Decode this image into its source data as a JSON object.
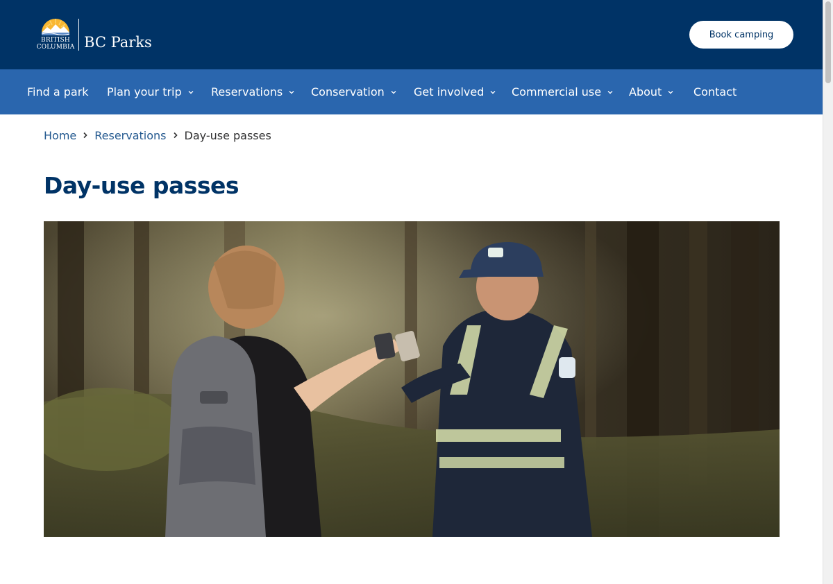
{
  "header": {
    "logo_sub_line1": "BRITISH",
    "logo_sub_line2": "COLUMBIA",
    "logo_name": "BC Parks",
    "book_button_label": "Book camping"
  },
  "nav": {
    "items": [
      {
        "label": "Find a park",
        "has_dropdown": false
      },
      {
        "label": "Plan your trip",
        "has_dropdown": true
      },
      {
        "label": "Reservations",
        "has_dropdown": true
      },
      {
        "label": "Conservation",
        "has_dropdown": true
      },
      {
        "label": "Get involved",
        "has_dropdown": true
      },
      {
        "label": "Commercial use",
        "has_dropdown": true
      },
      {
        "label": "About",
        "has_dropdown": true
      },
      {
        "label": "Contact",
        "has_dropdown": false
      }
    ]
  },
  "breadcrumb": {
    "home": "Home",
    "section": "Reservations",
    "current": "Day-use passes"
  },
  "page": {
    "title": "Day-use passes"
  },
  "hero": {
    "content": "photo"
  },
  "colors": {
    "header_bg": "#003366",
    "nav_bg": "#2a66ae",
    "link": "#255a90",
    "title": "#003366"
  },
  "icons": {
    "dropdown": "chevron-down-icon",
    "breadcrumb_separator": "chevron-right-icon",
    "logo_mark": "sun-mountains-icon"
  }
}
